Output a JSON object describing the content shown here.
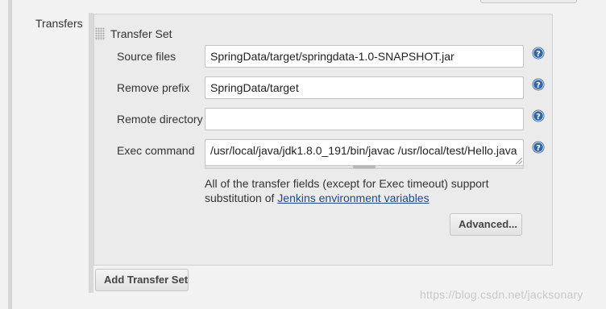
{
  "section": {
    "label": "Transfers"
  },
  "transfer_set": {
    "title": "Transfer Set",
    "fields": {
      "source_files": {
        "label": "Source files",
        "value": "SpringData/target/springdata-1.0-SNAPSHOT.jar"
      },
      "remove_prefix": {
        "label": "Remove prefix",
        "value": "SpringData/target"
      },
      "remote_directory": {
        "label": "Remote directory",
        "value": ""
      },
      "exec_command": {
        "label": "Exec command",
        "value": "/usr/local/java/jdk1.8.0_191/bin/javac /usr/local/test/Hello.java"
      }
    },
    "help_text": {
      "line1": "All of the transfer fields (except for Exec timeout) support",
      "line2_prefix": "substitution of ",
      "link": "Jenkins environment variables"
    },
    "advanced_button": "Advanced...",
    "add_button": "Add Transfer Set"
  },
  "watermark": "https://blog.csdn.net/jacksonary",
  "colors": {
    "help_icon": "#3465a4",
    "link": "#204a87",
    "panel": "#ebebeb",
    "page": "#f2f2f2"
  },
  "icons": {
    "help": "question-mark-circle",
    "grip": "dotted-drag-handle"
  }
}
